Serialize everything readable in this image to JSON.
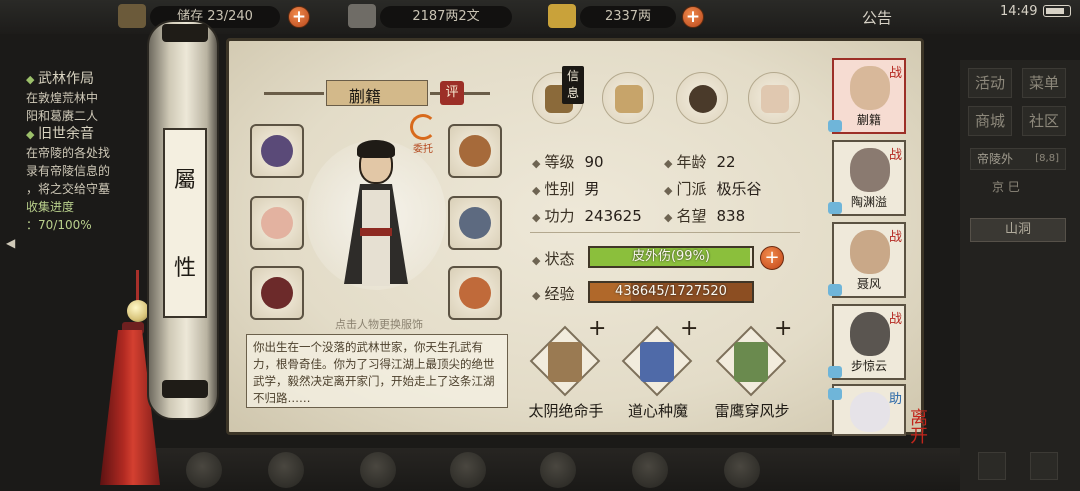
{
  "topbar": {
    "storage": "储存 23/240",
    "money": "2187两2文",
    "silver": "2337两",
    "notice": "公告",
    "time": "14:49",
    "colors": {
      "plus_button": "#d7622c"
    }
  },
  "left_panel": {
    "heading1": "武林作局",
    "line1": "在敦煌荒林中",
    "line2": "阳和葛赓二人",
    "heading2": "旧世余音",
    "line3": "在帝陵的各处找",
    "line4": "录有帝陵信息的",
    "line5": "，将之交给守墓",
    "progress_label": "收集进度",
    "progress": "：70/100%"
  },
  "right_menu": {
    "btn_activity": "活动",
    "btn_menu": "菜单",
    "btn_shop": "商城",
    "btn_community": "社区",
    "location": "帝陵外",
    "location_coords": "[8,8]",
    "sub": "京 巳",
    "cave": "山洞"
  },
  "scroll": {
    "label_char1": "屬",
    "label_char2": "性"
  },
  "character": {
    "name": "蒯籍",
    "rate_btn": "评",
    "delegate": "委托",
    "hint": "点击人物更换服饰",
    "bio": "你出生在一个没落的武林世家，你天生孔武有力，根骨奇佳。你为了习得江湖上最顶尖的绝世武学，毅然决定离开家门，开始走上了这条江湖不归路……"
  },
  "tabs": {
    "info_badge": "信息"
  },
  "stats": {
    "level_label": "等级",
    "level": "90",
    "age_label": "年龄",
    "age": "22",
    "gender_label": "性别",
    "gender": "男",
    "sect_label": "门派",
    "sect": "极乐谷",
    "power_label": "功力",
    "power": "243625",
    "fame_label": "名望",
    "fame": "838",
    "status_label": "状态",
    "status": "皮外伤(99%)",
    "status_fraction": 0.99,
    "exp_label": "经验",
    "exp": "438645/1727520",
    "exp_fraction": 0.254,
    "colors": {
      "status_fill": "#8bbf3c",
      "exp_fill": "#b0682a"
    }
  },
  "skills": [
    {
      "name": "太阴绝命手"
    },
    {
      "name": "道心种魔"
    },
    {
      "name": "雷鹰穿风步"
    }
  ],
  "party": {
    "members": [
      {
        "name": "蒯籍",
        "tag": "战"
      },
      {
        "name": "陶渊溢",
        "tag": "战"
      },
      {
        "name": "聂风",
        "tag": "战"
      },
      {
        "name": "步惊云",
        "tag": "战"
      },
      {
        "name": "",
        "tag": "助"
      }
    ],
    "leave": "离开"
  }
}
